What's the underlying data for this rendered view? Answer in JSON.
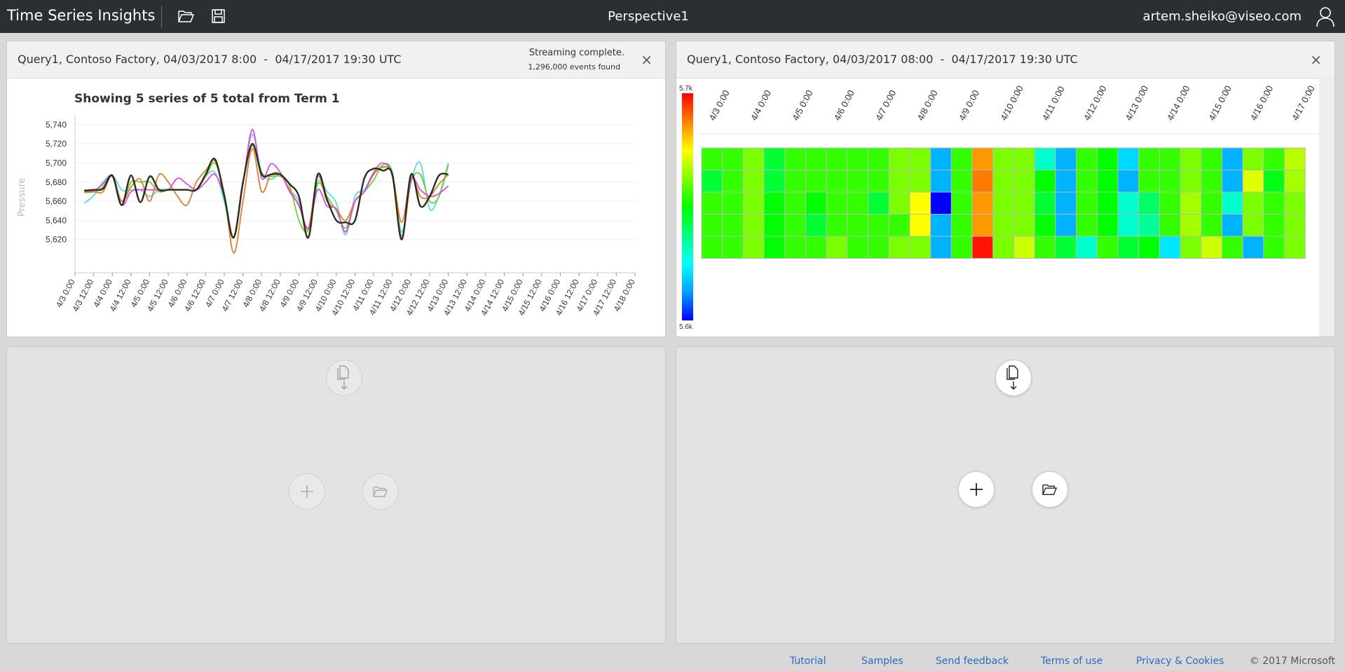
{
  "header": {
    "app_title": "Time Series Insights",
    "perspective": "Perspective1",
    "user_email": "artem.sheiko@viseo.com"
  },
  "panel1": {
    "title": "Query1, Contoso Factory, 04/03/2017 8:00  -  04/17/2017 19:30 UTC",
    "status": "Streaming complete.",
    "events": "1,296,000 events found",
    "close_label": "×",
    "chart_title": "Showing 5 series of 5 total from Term 1",
    "ylabel": "Pressure"
  },
  "panel2": {
    "title": "Query1, Contoso Factory, 04/03/2017 08:00  -  04/17/2017 19:30 UTC",
    "close_label": "×",
    "legend_max": "5.7k",
    "legend_min": "5.6k"
  },
  "footer": {
    "tutorial": "Tutorial",
    "samples": "Samples",
    "feedback": "Send feedback",
    "terms": "Terms of use",
    "privacy": "Privacy & Cookies",
    "copyright": "© 2017 Microsoft"
  },
  "chart_data": [
    {
      "type": "line",
      "title": "Showing 5 series of 5 total from Term 1",
      "ylabel": "Pressure",
      "ylim": [
        5600,
        5745
      ],
      "yticks": [
        5620,
        5640,
        5660,
        5680,
        5700,
        5720,
        5740
      ],
      "ytick_labels": [
        "5,620",
        "5,640",
        "5,660",
        "5,680",
        "5,700",
        "5,720",
        "5,740"
      ],
      "x": [
        "4/3 0:00",
        "4/3 12:00",
        "4/4 0:00",
        "4/4 12:00",
        "4/5 0:00",
        "4/5 12:00",
        "4/6 0:00",
        "4/6 12:00",
        "4/7 0:00",
        "4/7 12:00",
        "4/8 0:00",
        "4/8 12:00",
        "4/9 0:00",
        "4/9 12:00",
        "4/10 0:00",
        "4/10 12:00",
        "4/11 0:00",
        "4/11 12:00",
        "4/12 0:00",
        "4/12 12:00",
        "4/13 0:00",
        "4/13 12:00",
        "4/14 0:00",
        "4/14 12:00",
        "4/15 0:00",
        "4/15 12:00",
        "4/16 0:00",
        "4/16 12:00",
        "4/17 0:00",
        "4/17 12:00",
        "4/18 0:00"
      ],
      "grid": true,
      "series": [
        {
          "color": "#5fd8e6",
          "points": [
            [
              0.5,
              5658
            ],
            [
              1,
              5666
            ],
            [
              1.5,
              5680
            ],
            [
              2,
              5687
            ],
            [
              2.5,
              5672
            ],
            [
              3,
              5672
            ],
            [
              3.5,
              5672
            ],
            [
              4,
              5665
            ],
            [
              4.5,
              5672
            ],
            [
              5,
              5672
            ],
            [
              5.5,
              5672
            ],
            [
              6,
              5672
            ],
            [
              6.5,
              5672
            ],
            [
              7,
              5686
            ],
            [
              7.5,
              5690
            ],
            [
              8,
              5660
            ],
            [
              8.5,
              5622
            ],
            [
              9,
              5680
            ],
            [
              9.5,
              5730
            ],
            [
              10,
              5690
            ],
            [
              10.5,
              5683
            ],
            [
              11,
              5688
            ],
            [
              11.5,
              5672
            ],
            [
              12,
              5660
            ],
            [
              12.5,
              5630
            ],
            [
              13,
              5680
            ],
            [
              13.5,
              5670
            ],
            [
              14,
              5658
            ],
            [
              14.5,
              5625
            ],
            [
              15,
              5665
            ],
            [
              15.5,
              5672
            ],
            [
              16,
              5690
            ],
            [
              16.5,
              5695
            ],
            [
              17,
              5690
            ],
            [
              17.5,
              5628
            ],
            [
              18,
              5680
            ],
            [
              18.5,
              5700
            ],
            [
              19,
              5652
            ],
            [
              19.5,
              5666
            ],
            [
              20,
              5700
            ]
          ]
        },
        {
          "color": "#6ad234",
          "points": [
            [
              0.5,
              5669
            ],
            [
              1,
              5670
            ],
            [
              1.5,
              5675
            ],
            [
              2,
              5686
            ],
            [
              2.5,
              5660
            ],
            [
              3,
              5680
            ],
            [
              3.5,
              5680
            ],
            [
              4,
              5680
            ],
            [
              4.5,
              5670
            ],
            [
              5,
              5672
            ],
            [
              5.5,
              5672
            ],
            [
              6,
              5672
            ],
            [
              6.5,
              5672
            ],
            [
              7,
              5686
            ],
            [
              7.5,
              5700
            ],
            [
              8,
              5668
            ],
            [
              8.5,
              5622
            ],
            [
              9,
              5680
            ],
            [
              9.5,
              5718
            ],
            [
              10,
              5690
            ],
            [
              10.5,
              5686
            ],
            [
              11,
              5686
            ],
            [
              11.5,
              5676
            ],
            [
              12,
              5640
            ],
            [
              12.5,
              5630
            ],
            [
              13,
              5678
            ],
            [
              13.5,
              5665
            ],
            [
              14,
              5650
            ],
            [
              14.5,
              5632
            ],
            [
              15,
              5660
            ],
            [
              15.5,
              5670
            ],
            [
              16,
              5682
            ],
            [
              16.5,
              5698
            ],
            [
              17,
              5690
            ],
            [
              17.5,
              5624
            ],
            [
              18,
              5680
            ],
            [
              18.5,
              5688
            ],
            [
              19,
              5660
            ],
            [
              19.5,
              5665
            ],
            [
              20,
              5698
            ]
          ]
        },
        {
          "color": "#e0802b",
          "points": [
            [
              0.5,
              5670
            ],
            [
              1,
              5670
            ],
            [
              1.5,
              5670
            ],
            [
              2,
              5687
            ],
            [
              2.5,
              5660
            ],
            [
              3,
              5675
            ],
            [
              3.5,
              5683
            ],
            [
              4,
              5660
            ],
            [
              4.5,
              5688
            ],
            [
              5,
              5680
            ],
            [
              5.5,
              5665
            ],
            [
              6,
              5656
            ],
            [
              6.5,
              5680
            ],
            [
              7,
              5692
            ],
            [
              7.5,
              5702
            ],
            [
              8,
              5668
            ],
            [
              8.5,
              5606
            ],
            [
              9,
              5660
            ],
            [
              9.5,
              5715
            ],
            [
              10,
              5670
            ],
            [
              10.5,
              5688
            ],
            [
              11,
              5688
            ],
            [
              11.5,
              5672
            ],
            [
              12,
              5655
            ],
            [
              12.5,
              5632
            ],
            [
              13,
              5686
            ],
            [
              13.5,
              5660
            ],
            [
              14,
              5652
            ],
            [
              14.5,
              5640
            ],
            [
              15,
              5660
            ],
            [
              15.5,
              5670
            ],
            [
              16,
              5688
            ],
            [
              16.5,
              5696
            ],
            [
              17,
              5688
            ],
            [
              17.5,
              5638
            ],
            [
              18,
              5685
            ],
            [
              18.5,
              5665
            ],
            [
              19,
              5665
            ],
            [
              19.5,
              5678
            ],
            [
              20,
              5688
            ]
          ]
        },
        {
          "color": "#d94ee0",
          "points": [
            [
              0.5,
              5672
            ],
            [
              1,
              5671
            ],
            [
              1.5,
              5678
            ],
            [
              2,
              5686
            ],
            [
              2.5,
              5656
            ],
            [
              3,
              5670
            ],
            [
              3.5,
              5672
            ],
            [
              4,
              5672
            ],
            [
              4.5,
              5672
            ],
            [
              5,
              5672
            ],
            [
              5.5,
              5684
            ],
            [
              6,
              5678
            ],
            [
              6.5,
              5672
            ],
            [
              7,
              5680
            ],
            [
              7.5,
              5688
            ],
            [
              8,
              5665
            ],
            [
              8.5,
              5622
            ],
            [
              9,
              5678
            ],
            [
              9.5,
              5735
            ],
            [
              10,
              5684
            ],
            [
              10.5,
              5699
            ],
            [
              11,
              5690
            ],
            [
              11.5,
              5670
            ],
            [
              12,
              5656
            ],
            [
              12.5,
              5632
            ],
            [
              13,
              5672
            ],
            [
              13.5,
              5655
            ],
            [
              14,
              5652
            ],
            [
              14.5,
              5628
            ],
            [
              15,
              5660
            ],
            [
              15.5,
              5670
            ],
            [
              16,
              5690
            ],
            [
              16.5,
              5700
            ],
            [
              17,
              5686
            ],
            [
              17.5,
              5622
            ],
            [
              18,
              5682
            ],
            [
              18.5,
              5672
            ],
            [
              19,
              5665
            ],
            [
              19.5,
              5668
            ],
            [
              20,
              5676
            ]
          ]
        },
        {
          "color": "#2a2f1c",
          "points": [
            [
              0.5,
              5671
            ],
            [
              1,
              5672
            ],
            [
              1.5,
              5673
            ],
            [
              2,
              5687
            ],
            [
              2.5,
              5656
            ],
            [
              3,
              5687
            ],
            [
              3.5,
              5659
            ],
            [
              4,
              5686
            ],
            [
              4.5,
              5672
            ],
            [
              5,
              5672
            ],
            [
              5.5,
              5672
            ],
            [
              6,
              5672
            ],
            [
              6.5,
              5672
            ],
            [
              7,
              5688
            ],
            [
              7.5,
              5704
            ],
            [
              8,
              5665
            ],
            [
              8.5,
              5622
            ],
            [
              9,
              5680
            ],
            [
              9.5,
              5720
            ],
            [
              10,
              5688
            ],
            [
              10.5,
              5688
            ],
            [
              11,
              5688
            ],
            [
              11.5,
              5678
            ],
            [
              12,
              5665
            ],
            [
              12.5,
              5622
            ],
            [
              13,
              5688
            ],
            [
              13.5,
              5662
            ],
            [
              14,
              5640
            ],
            [
              14.5,
              5638
            ],
            [
              15,
              5640
            ],
            [
              15.5,
              5684
            ],
            [
              16,
              5694
            ],
            [
              16.5,
              5692
            ],
            [
              17,
              5688
            ],
            [
              17.5,
              5620
            ],
            [
              18,
              5688
            ],
            [
              18.5,
              5655
            ],
            [
              19,
              5665
            ],
            [
              19.5,
              5687
            ],
            [
              20,
              5688
            ]
          ]
        }
      ]
    },
    {
      "type": "heatmap",
      "x": [
        "4/3 0:00",
        "4/4 0:00",
        "4/5 0:00",
        "4/6 0:00",
        "4/7 0:00",
        "4/8 0:00",
        "4/9 0:00",
        "4/10 0:00",
        "4/11 0:00",
        "4/12 0:00",
        "4/13 0:00",
        "4/14 0:00",
        "4/15 0:00",
        "4/16 0:00",
        "4/17 0:00"
      ],
      "legend": {
        "max": "5.7k",
        "min": "5.6k"
      },
      "colormap": [
        "#0000ff",
        "#00a0ff",
        "#00ffff",
        "#00ff80",
        "#00ff00",
        "#80ff00",
        "#ffff00",
        "#ff8000",
        "#ff0000"
      ],
      "values": [
        [
          0.55,
          0.55,
          0.62,
          0.45,
          0.55,
          0.55,
          0.55,
          0.55,
          0.55,
          0.62,
          0.62,
          0.15,
          0.55,
          0.85,
          0.62,
          0.62,
          0.3,
          0.15,
          0.55,
          0.5,
          0.2,
          0.55,
          0.55,
          0.62,
          0.55,
          0.15,
          0.62,
          0.55,
          0.68
        ],
        [
          0.45,
          0.55,
          0.62,
          0.45,
          0.55,
          0.55,
          0.55,
          0.55,
          0.55,
          0.62,
          0.62,
          0.15,
          0.55,
          0.88,
          0.62,
          0.62,
          0.5,
          0.15,
          0.55,
          0.5,
          0.15,
          0.55,
          0.55,
          0.62,
          0.55,
          0.15,
          0.72,
          0.48,
          0.66
        ],
        [
          0.55,
          0.55,
          0.62,
          0.5,
          0.55,
          0.5,
          0.55,
          0.55,
          0.45,
          0.62,
          0.75,
          0.0,
          0.55,
          0.85,
          0.62,
          0.62,
          0.45,
          0.15,
          0.55,
          0.5,
          0.3,
          0.4,
          0.55,
          0.66,
          0.55,
          0.3,
          0.62,
          0.55,
          0.62
        ],
        [
          0.55,
          0.55,
          0.62,
          0.5,
          0.55,
          0.45,
          0.55,
          0.55,
          0.55,
          0.55,
          0.75,
          0.15,
          0.55,
          0.85,
          0.62,
          0.62,
          0.5,
          0.15,
          0.55,
          0.5,
          0.3,
          0.35,
          0.55,
          0.66,
          0.55,
          0.15,
          0.62,
          0.55,
          0.62
        ],
        [
          0.55,
          0.55,
          0.62,
          0.5,
          0.55,
          0.55,
          0.62,
          0.55,
          0.55,
          0.62,
          0.62,
          0.15,
          0.55,
          0.98,
          0.62,
          0.7,
          0.55,
          0.45,
          0.3,
          0.55,
          0.45,
          0.5,
          0.22,
          0.62,
          0.7,
          0.55,
          0.15,
          0.55,
          0.62
        ]
      ]
    }
  ]
}
